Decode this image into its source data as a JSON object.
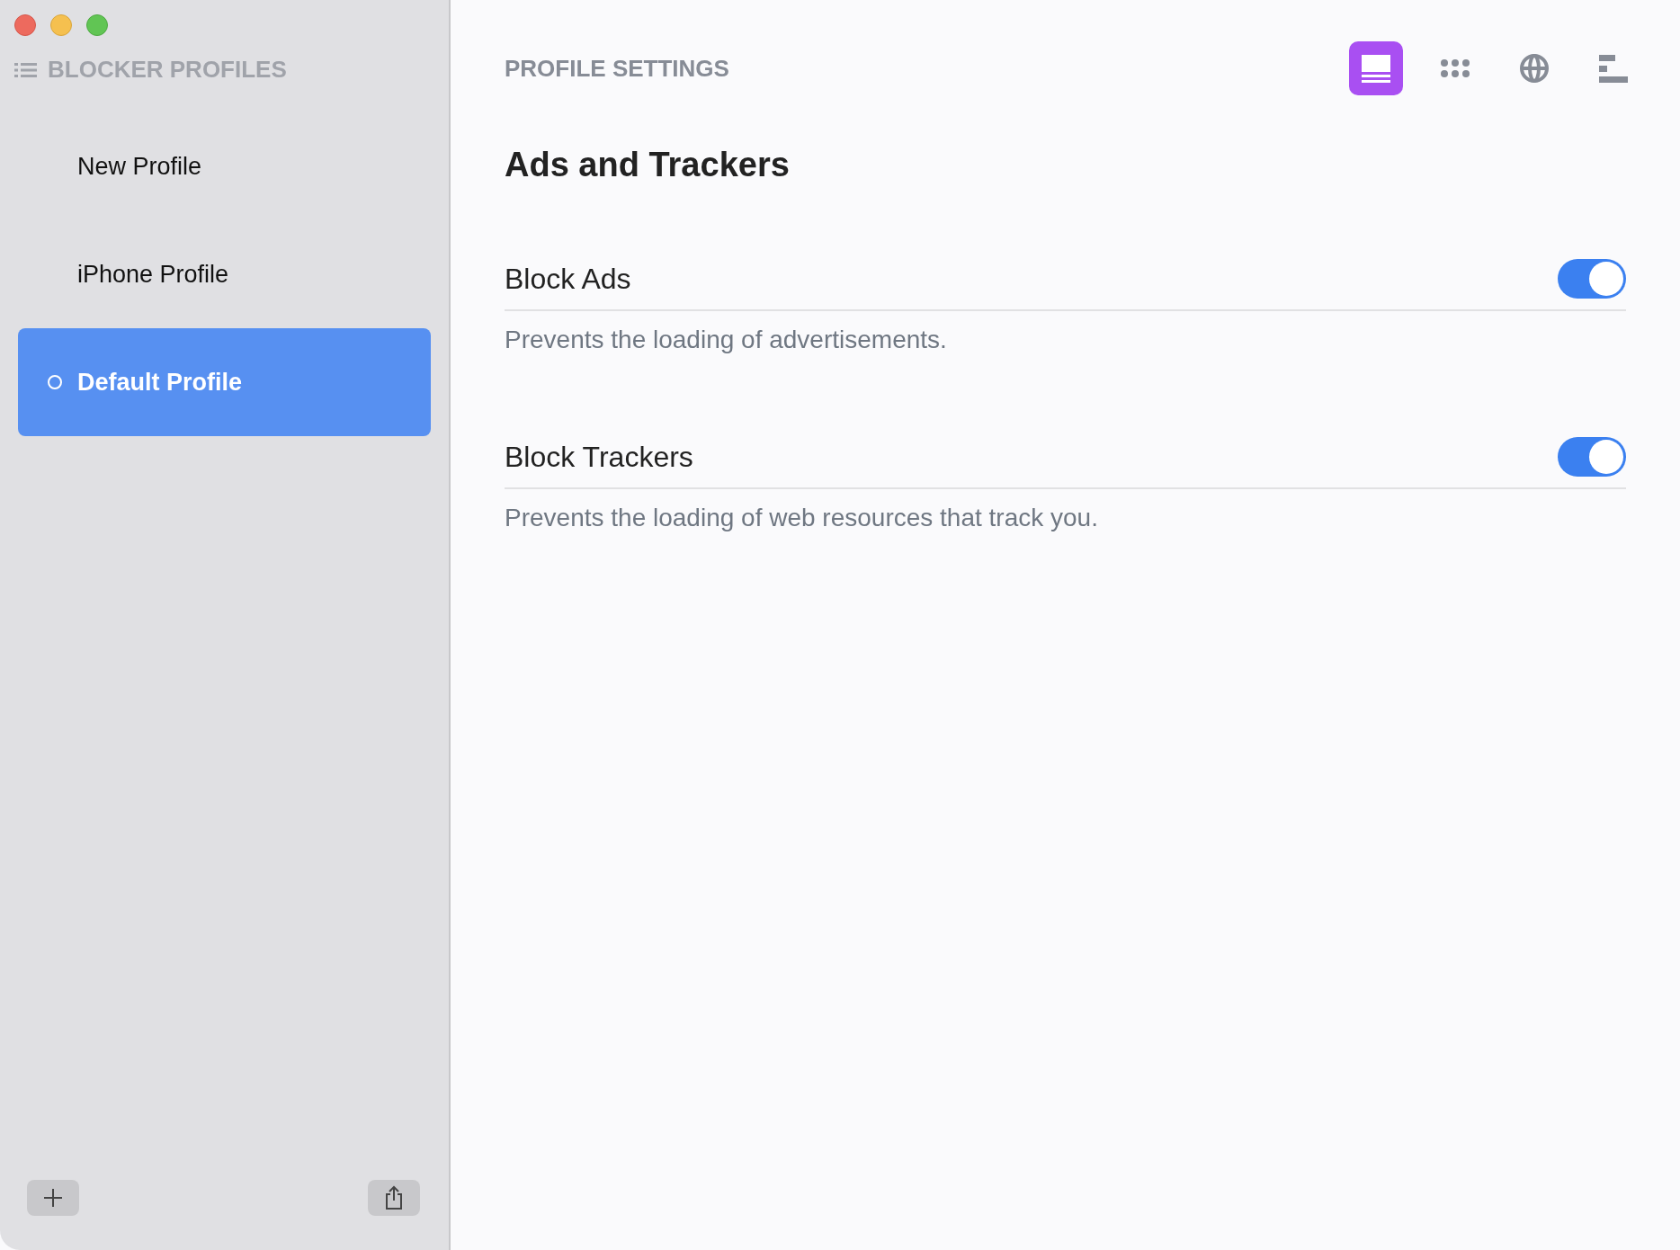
{
  "sidebar": {
    "header": "BLOCKER PROFILES",
    "items": [
      {
        "label": "New Profile",
        "selected": false
      },
      {
        "label": "iPhone Profile",
        "selected": false
      },
      {
        "label": "Default Profile",
        "selected": true
      }
    ]
  },
  "content": {
    "header": "PROFILE SETTINGS",
    "toolbar": [
      {
        "kind": "panel",
        "selected": true
      },
      {
        "kind": "dots",
        "selected": false
      },
      {
        "kind": "globe",
        "selected": false
      },
      {
        "kind": "bars",
        "selected": false
      }
    ],
    "section_title": "Ads and Trackers",
    "settings": [
      {
        "label": "Block Ads",
        "on": true,
        "description": "Prevents the loading of advertisements."
      },
      {
        "label": "Block Trackers",
        "on": true,
        "description": "Prevents the loading of web resources that track you."
      }
    ]
  }
}
